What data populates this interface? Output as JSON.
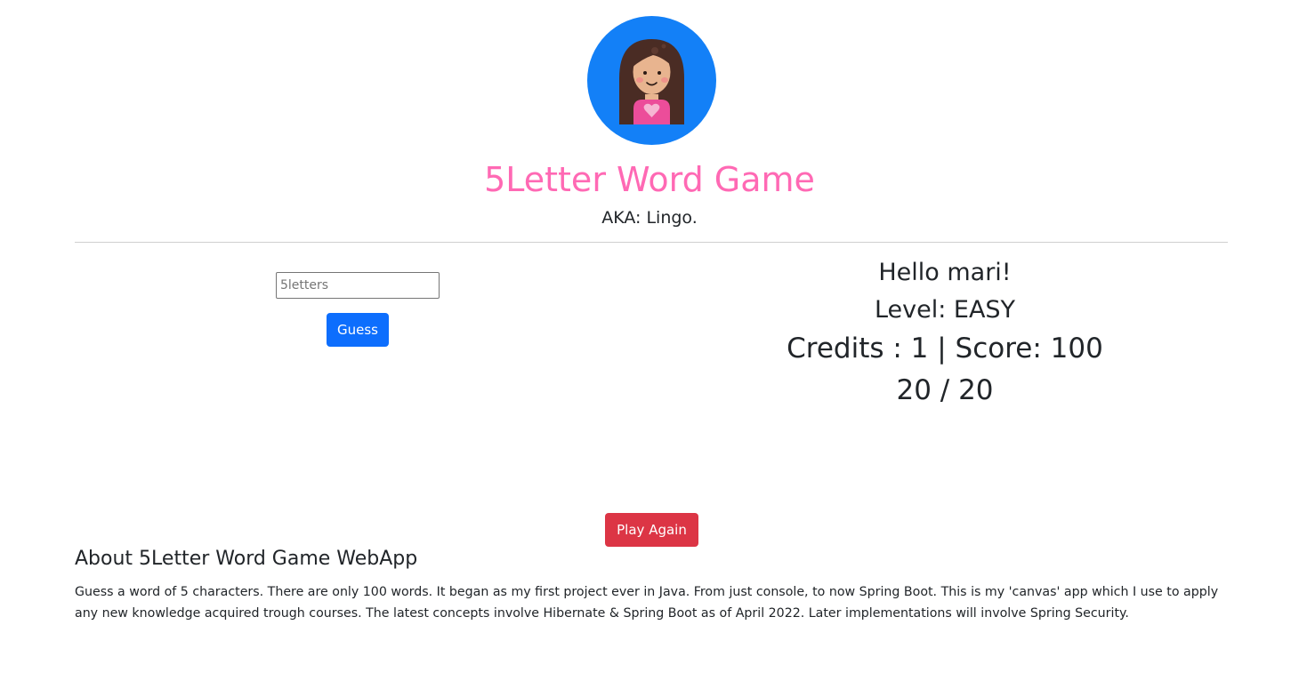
{
  "header": {
    "title": "5Letter Word Game",
    "subtitle": "AKA: Lingo."
  },
  "game": {
    "input_placeholder": "5letters",
    "input_value": "",
    "guess_label": "Guess",
    "play_again_label": "Play Again"
  },
  "stats": {
    "greeting": "Hello mari!",
    "level": "Level: EASY",
    "credits_score": "Credits : 1 | Score: 100",
    "progress": "20 / 20"
  },
  "about": {
    "heading": "About 5Letter Word Game WebApp",
    "text": "Guess a word of 5 characters. There are only 100 words. It began as my first project ever in Java. From just console, to now Spring Boot. This is my 'canvas' app which I use to apply any new knowledge acquired trough courses. The latest concepts involve Hibernate & Spring Boot as of April 2022. Later implementations will involve Spring Security."
  },
  "colors": {
    "title": "#ff69b4",
    "avatar_bg": "#1380f7",
    "primary_button": "#0d6efd",
    "danger_button": "#dc3545"
  },
  "icons": {
    "avatar": "girl-avatar-icon"
  }
}
